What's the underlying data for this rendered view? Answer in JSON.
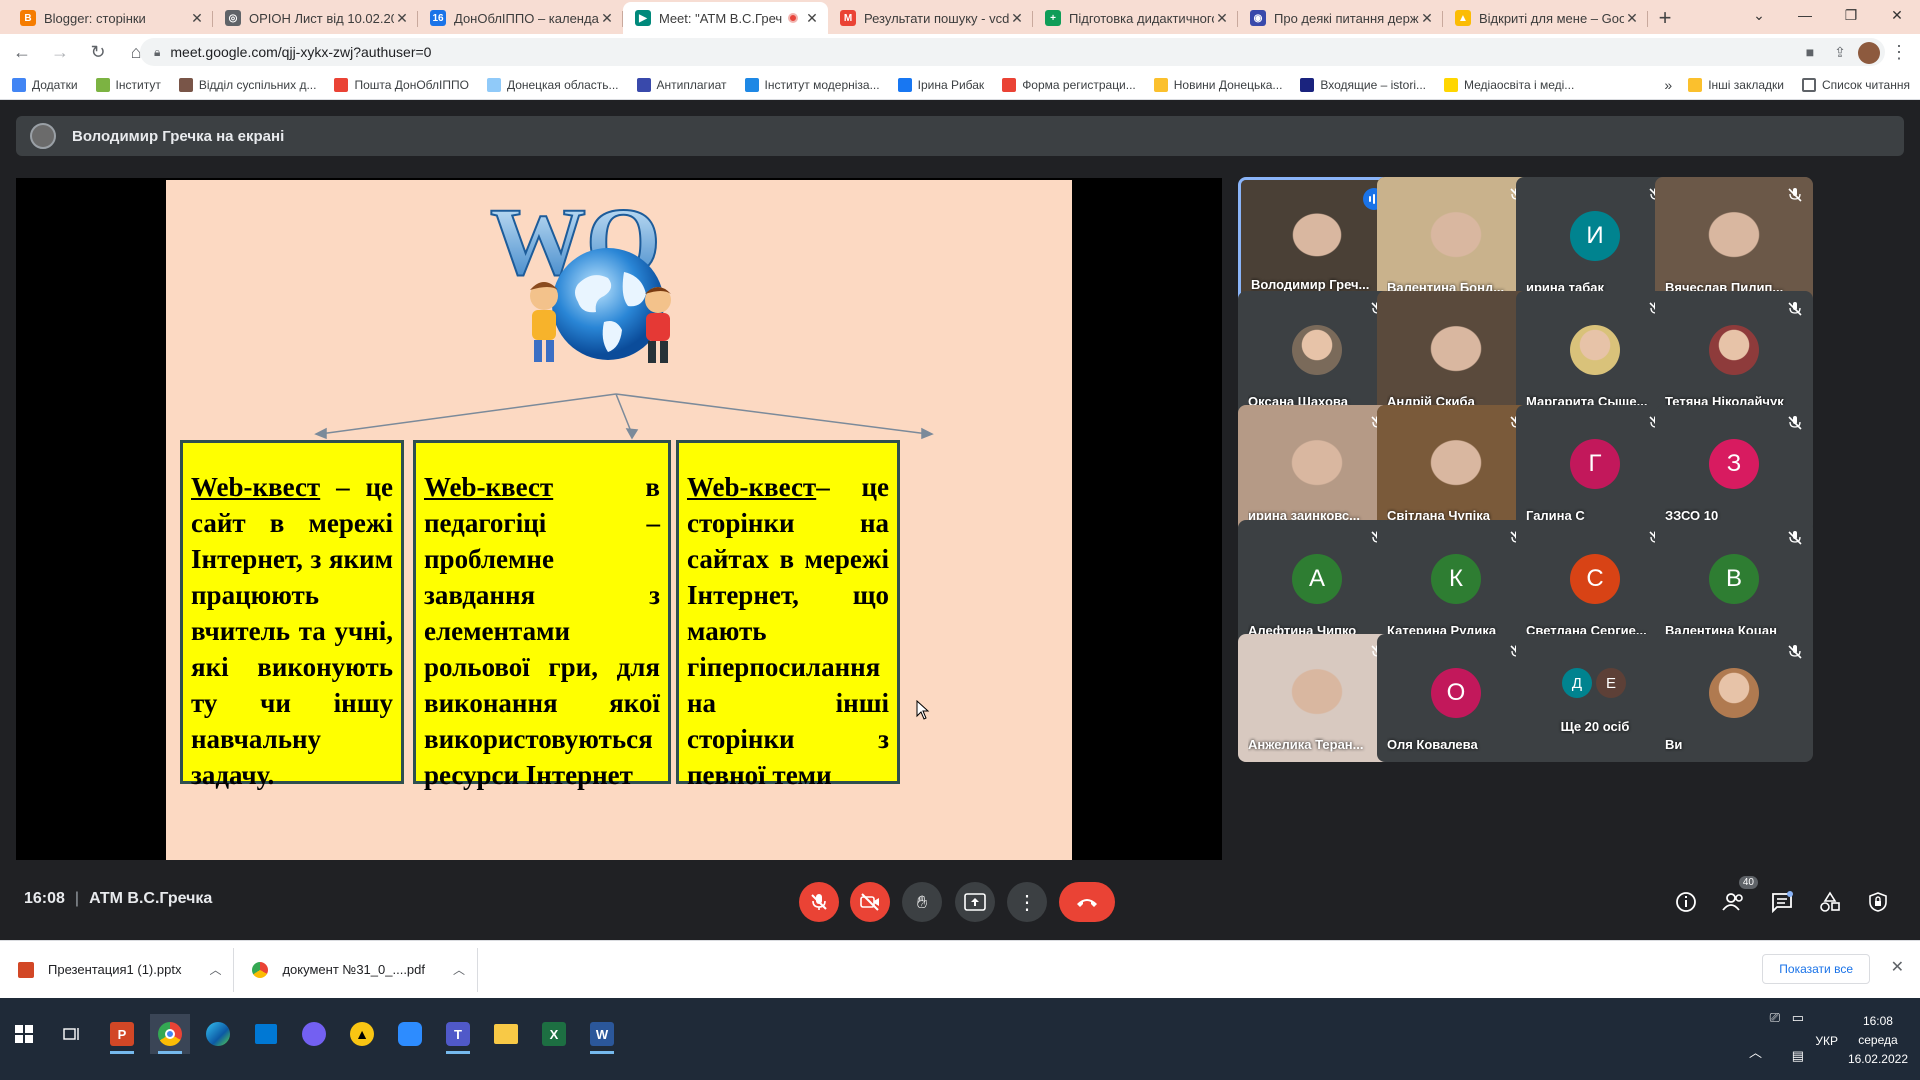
{
  "browser": {
    "tabs": [
      {
        "title": "Blogger: сторінки",
        "color": "#f57c00",
        "glyph": "B"
      },
      {
        "title": "ОРІОН Лист від 10.02.2022",
        "color": "#5f6368",
        "glyph": "◎"
      },
      {
        "title": "ДонОблІППО – календар",
        "color": "#1a73e8",
        "glyph": "16"
      },
      {
        "title": "Meet: \"АТМ В.С.Гречка",
        "color": "#00897b",
        "glyph": "▶",
        "active": true
      },
      {
        "title": "Результати пошуку - vcd@",
        "color": "#ea4335",
        "glyph": "M"
      },
      {
        "title": "Підготовка дидактичного",
        "color": "#0f9d58",
        "glyph": "+"
      },
      {
        "title": "Про деякі питання держа",
        "color": "#3949ab",
        "glyph": "◉"
      },
      {
        "title": "Відкриті для мене – Googl",
        "color": "#fbbc04",
        "glyph": "▲"
      }
    ],
    "url": "meet.google.com/qjj-xykx-zwj?authuser=0",
    "bookmarks": [
      {
        "label": "Додатки",
        "color": "#4285f4"
      },
      {
        "label": "Інститут",
        "color": "#7cb342"
      },
      {
        "label": "Відділ суспільних д...",
        "color": "#795548"
      },
      {
        "label": "Пошта ДонОблІППО",
        "color": "#ea4335"
      },
      {
        "label": "Донецкая область...",
        "color": "#90caf9"
      },
      {
        "label": "Антиплагиат",
        "color": "#3949ab"
      },
      {
        "label": "Інститут модерніза...",
        "color": "#1e88e5"
      },
      {
        "label": "Ірина Рибак",
        "color": "#1877f2"
      },
      {
        "label": "Форма регистраци...",
        "color": "#ea4335"
      },
      {
        "label": "Новини Донецька...",
        "color": "#fbc02d"
      },
      {
        "label": "Входящие – istori...",
        "color": "#1a237e"
      },
      {
        "label": "Медіаосвіта і меді...",
        "color": "#ffd600"
      }
    ],
    "bookmarks_more": "»",
    "other_bookmarks": "Інші закладки",
    "reading_list": "Список читання"
  },
  "meet": {
    "presenter_label": "Володимир Гречка на екрані",
    "slide": {
      "logo_text": "WQ",
      "boxes": [
        {
          "term": "Web-квест",
          "text": " – це сайт в мережі Інтернет, з яким працюють вчитель та учні, які виконують ту чи іншу навчальну задачу."
        },
        {
          "term": "Web-квест",
          "text": " в педагогіці – проблемне завдання з елементами рольової гри, для виконання якої використовуються ресурси Інтернет"
        },
        {
          "term": "Web-квест",
          "text": "– це сторінки на сайтах в мережі Інтернет, що мають гіперпосилання на інші сторінки з певної теми"
        }
      ]
    },
    "participants": [
      {
        "name": "Володимир Греч...",
        "kind": "video",
        "speaking": true,
        "muted": false
      },
      {
        "name": "Валентина Бонд...",
        "kind": "video",
        "muted": true
      },
      {
        "name": "ирина табак",
        "kind": "letter",
        "letter": "И",
        "color": "#00838f",
        "muted": true
      },
      {
        "name": "Вячеслав Пилип...",
        "kind": "video",
        "muted": true
      },
      {
        "name": "Оксана Шахова",
        "kind": "photo",
        "color": "#7a6a5a",
        "muted": true
      },
      {
        "name": "Андрій Скиба",
        "kind": "video",
        "muted": false
      },
      {
        "name": "Маргарита Сыще...",
        "kind": "photo",
        "color": "#d9c27a",
        "muted": true
      },
      {
        "name": "Тетяна Ніколайчук",
        "kind": "photo",
        "color": "#8e3b3b",
        "muted": true
      },
      {
        "name": "ирина заинковс...",
        "kind": "video",
        "muted": true
      },
      {
        "name": "Світлана Чупіка",
        "kind": "video",
        "muted": true
      },
      {
        "name": "Галина С",
        "kind": "letter",
        "letter": "Г",
        "color": "#c2185b",
        "muted": true
      },
      {
        "name": "ЗЗСО 10",
        "kind": "letter",
        "letter": "З",
        "color": "#d81b60",
        "muted": true
      },
      {
        "name": "Алефтина Чипко",
        "kind": "letter",
        "letter": "А",
        "color": "#2e7d32",
        "muted": true
      },
      {
        "name": "Катерина Рудика",
        "kind": "letter",
        "letter": "К",
        "color": "#2e7d32",
        "muted": true
      },
      {
        "name": "Светлана Сергие...",
        "kind": "letter",
        "letter": "С",
        "color": "#d84315",
        "muted": true
      },
      {
        "name": "Валентина Коцан",
        "kind": "letter",
        "letter": "В",
        "color": "#2e7d32",
        "muted": true
      },
      {
        "name": "Анжелика Теран...",
        "kind": "video",
        "muted": true
      },
      {
        "name": "Оля Ковалева",
        "kind": "letter",
        "letter": "О",
        "color": "#c2185b",
        "muted": true
      },
      {
        "name": "Ще 20 осіб",
        "kind": "more",
        "letters": [
          "Д",
          "Е"
        ],
        "colors": [
          "#00838f",
          "#5d4037"
        ],
        "muted": false
      },
      {
        "name": "Ви",
        "kind": "photo",
        "color": "#b07a50",
        "muted": true
      }
    ],
    "time": "16:08",
    "meeting_name": "АТМ В.С.Гречка",
    "people_count": "40"
  },
  "downloads": {
    "items": [
      {
        "name": "Презентация1 (1).pptx",
        "color": "#d24726"
      },
      {
        "name": "документ №31_0_....pdf",
        "color": "#4285f4"
      }
    ],
    "show_all": "Показати все"
  },
  "taskbar": {
    "lang": "УКР",
    "time": "16:08",
    "day": "середа",
    "date": "16.02.2022"
  }
}
